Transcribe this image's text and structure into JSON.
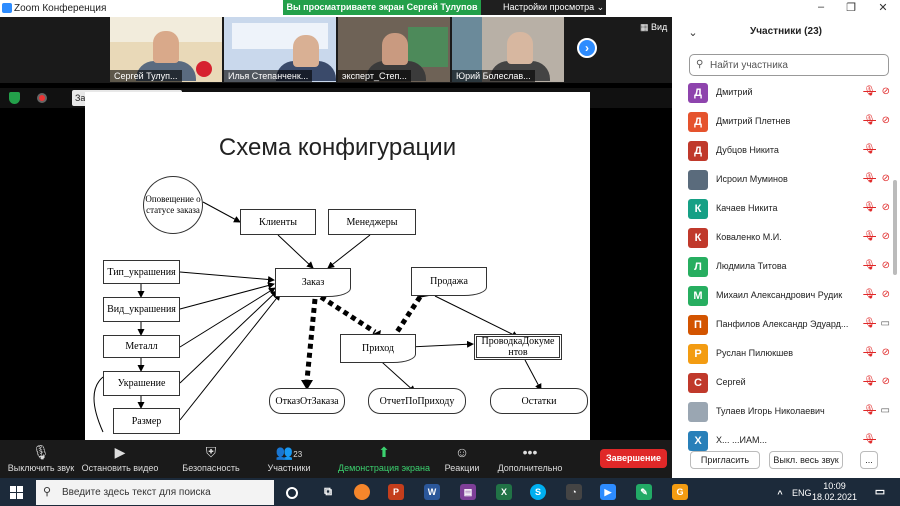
{
  "window": {
    "title": "Zoom Конференция",
    "share_banner": "Вы просматриваете экран Сергей Тулупов",
    "view_options": "Настройки просмотра ⌄",
    "view_button": "Вид"
  },
  "thumbnails": [
    {
      "name": "Сергей Тулуп...",
      "bg": "#e9d9b8"
    },
    {
      "name": "Илья Степанченк...",
      "bg": "#c9d8ec"
    },
    {
      "name": "эксперт_Степ...",
      "bg": "#8a7a6a"
    },
    {
      "name": "Юрий Болеслав...",
      "bg": "#b8b0a6"
    }
  ],
  "recording": {
    "label": "Запись...",
    "pause_icon": "pause-icon",
    "stop_icon": "stop-icon"
  },
  "slide": {
    "title": "Схема конфигурации",
    "nodes": {
      "notify": "Оповещение о статусе заказа",
      "clients": "Клиенты",
      "managers": "Менеджеры",
      "order": "Заказ",
      "sale": "Продажа",
      "type": "Тип_украшения",
      "kind": "Вид_украшения",
      "metal": "Металл",
      "jewel": "Украшение",
      "size": "Размер",
      "income": "Приход",
      "posting": "ПроводкаДокументов",
      "refusal": "ОтказОтЗаказа",
      "report": "ОтчетПоПриходу",
      "balance": "Остатки"
    }
  },
  "toolbar": {
    "mute": "Выключить звук",
    "video": "Остановить видео",
    "security": "Безопасность",
    "participants": "Участники",
    "participants_count": "23",
    "share": "Демонстрация экрана",
    "reactions": "Реакции",
    "more": "Дополнительно",
    "end": "Завершение"
  },
  "panel": {
    "header": "Участники (23)",
    "search_placeholder": "Найти участника",
    "participants": [
      {
        "initial": "Д",
        "name": "Дмитрий",
        "color": "#8e44ad",
        "cam": "off"
      },
      {
        "initial": "Д",
        "name": "Дмитрий Плетнев",
        "color": "#e5532d",
        "cam": "off"
      },
      {
        "initial": "Д",
        "name": "Дубцов Никита",
        "color": "#c0392b",
        "cam": "none"
      },
      {
        "initial": "",
        "name": "Исроил Муминов",
        "color": "#5a6b7c",
        "cam": "off"
      },
      {
        "initial": "К",
        "name": "Качаев Никита",
        "color": "#16a085",
        "cam": "off"
      },
      {
        "initial": "К",
        "name": "Коваленко М.И.",
        "color": "#c0392b",
        "cam": "off"
      },
      {
        "initial": "Л",
        "name": "Людмила Титова",
        "color": "#27ae60",
        "cam": "off"
      },
      {
        "initial": "М",
        "name": "Михаил Александрович Рудик",
        "color": "#27ae60",
        "cam": "off"
      },
      {
        "initial": "П",
        "name": "Панфилов Александр Эдуард...",
        "color": "#d35400",
        "cam": "on"
      },
      {
        "initial": "Р",
        "name": "Руслан Пилюкшев",
        "color": "#f39c12",
        "cam": "off"
      },
      {
        "initial": "С",
        "name": "Сергей",
        "color": "#c0392b",
        "cam": "off"
      },
      {
        "initial": "",
        "name": "Тулаев Игорь Николаевич",
        "color": "#9aa6b2",
        "cam": "on"
      },
      {
        "initial": "Х",
        "name": "Х... ...ИАМ...",
        "color": "#2980b9",
        "cam": "none"
      }
    ],
    "invite": "Пригласить",
    "mute_all": "Выкл. весь звук",
    "more": "..."
  },
  "taskbar": {
    "search_placeholder": "Введите здесь текст для поиска",
    "lang": "ENG",
    "time": "10:09",
    "date": "18.02.2021"
  }
}
